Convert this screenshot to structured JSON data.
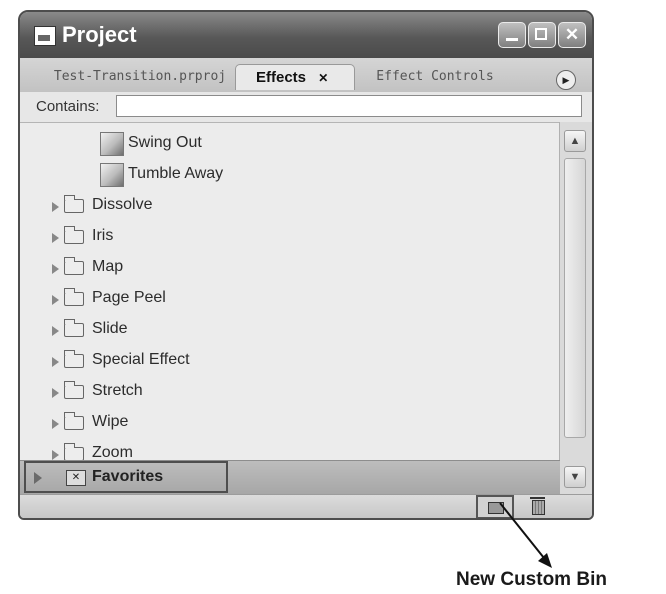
{
  "window": {
    "title": "Project",
    "tabs": [
      {
        "label": "Test-Transition.prproj",
        "active": false
      },
      {
        "label": "Effects",
        "active": true,
        "close": "✕"
      },
      {
        "label": "Effect Controls",
        "active": false
      }
    ]
  },
  "search": {
    "label": "Contains:",
    "value": ""
  },
  "effects_list": [
    {
      "label": "Swing Out",
      "type": "effect"
    },
    {
      "label": "Tumble Away",
      "type": "effect"
    },
    {
      "label": "Dissolve",
      "type": "folder"
    },
    {
      "label": "Iris",
      "type": "folder"
    },
    {
      "label": "Map",
      "type": "folder"
    },
    {
      "label": "Page Peel",
      "type": "folder"
    },
    {
      "label": "Slide",
      "type": "folder"
    },
    {
      "label": "Special Effect",
      "type": "folder"
    },
    {
      "label": "Stretch",
      "type": "folder"
    },
    {
      "label": "Wipe",
      "type": "folder"
    },
    {
      "label": "Zoom",
      "type": "folder"
    }
  ],
  "favorites": {
    "label": "Favorites"
  },
  "annotation": {
    "label": "New Custom Bin"
  },
  "icons": {
    "app": "project-icon",
    "minimize": "minimize-icon",
    "maximize": "maximize-icon",
    "close": "close-icon",
    "menu": "panel-menu-icon",
    "effect": "transition-effect-icon",
    "folder": "folder-icon",
    "expand": "expand-triangle-icon",
    "favorites": "favorites-bin-icon",
    "new_bin": "new-custom-bin-icon",
    "delete": "trash-icon"
  }
}
